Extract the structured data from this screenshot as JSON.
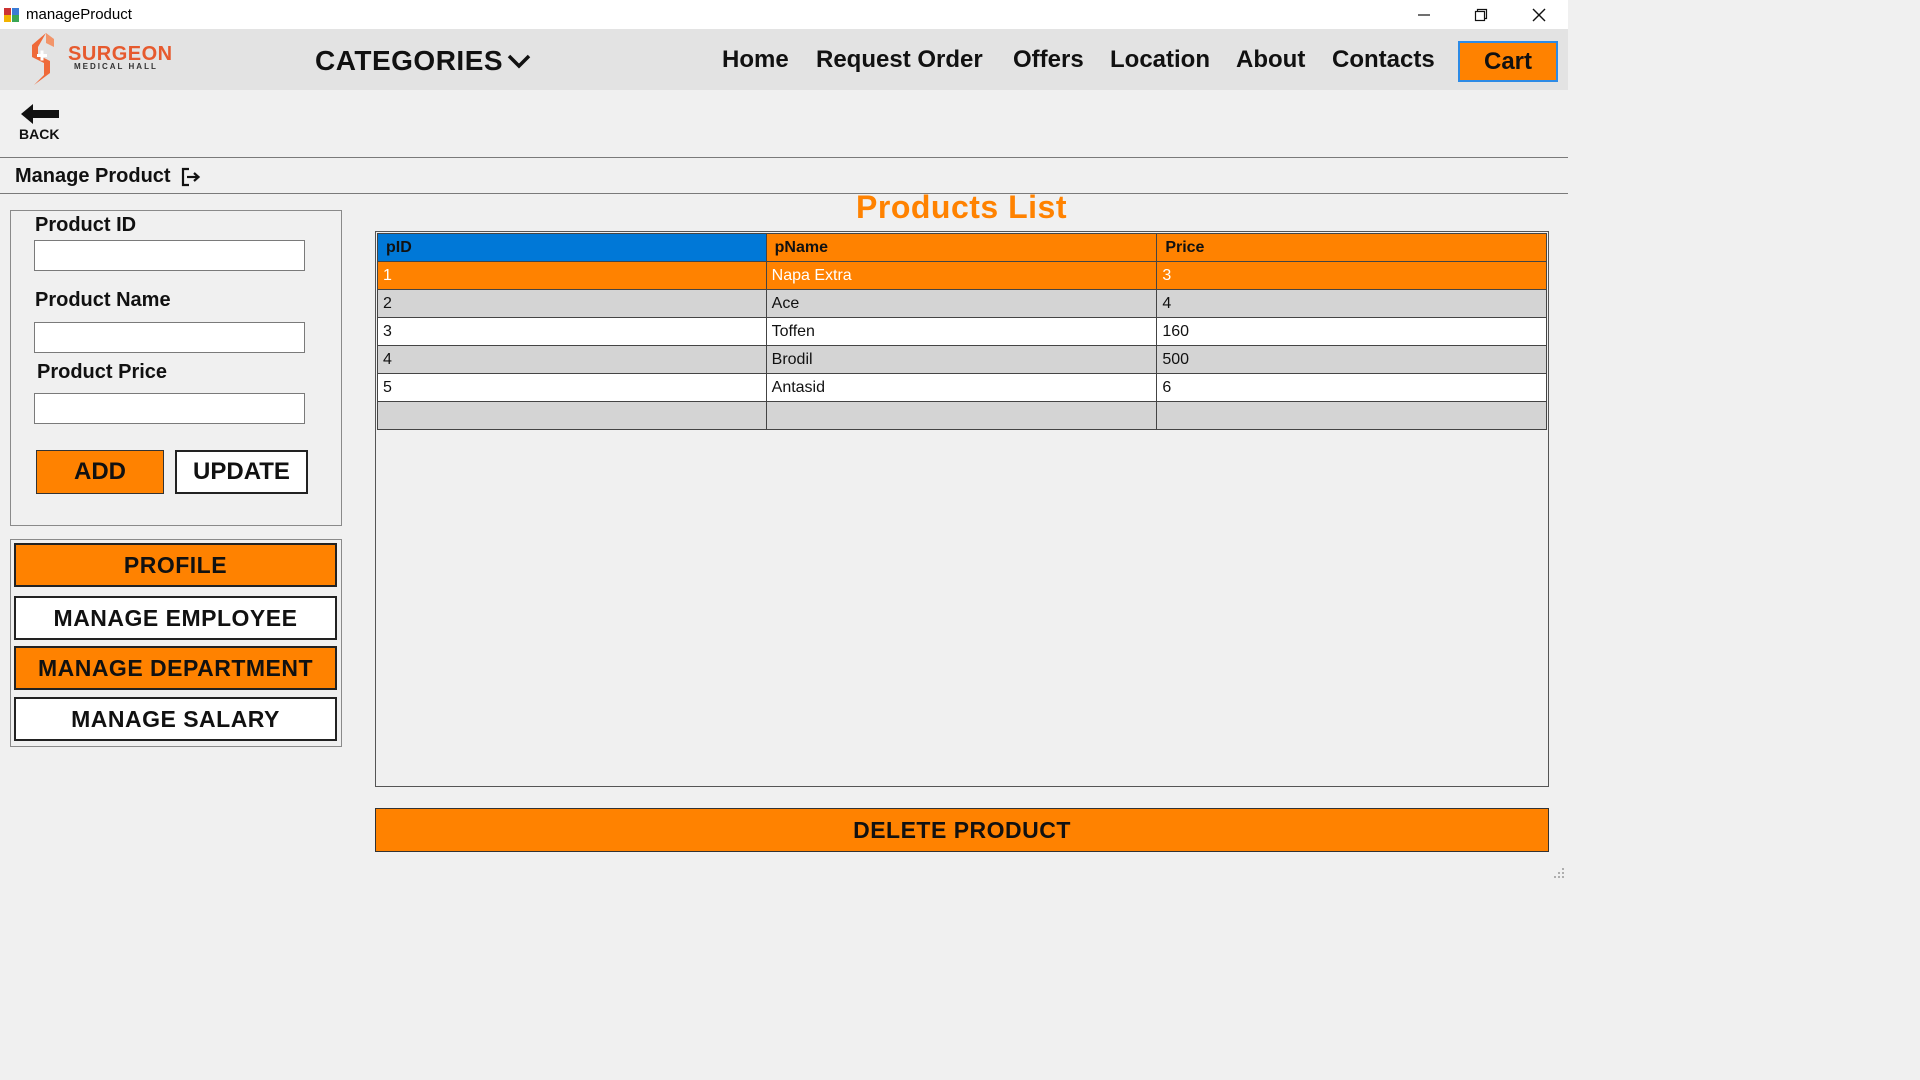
{
  "window": {
    "title": "manageProduct",
    "minimize_icon": "minimize-icon",
    "restore_icon": "restore-icon",
    "close_icon": "close-icon"
  },
  "navbar": {
    "logo_line1": "SURGEON",
    "logo_line2": "MEDICAL HALL",
    "categories": "CATEGORIES",
    "links": [
      "Home",
      "Request Order",
      "Offers",
      "Location",
      "About",
      "Contacts"
    ],
    "cart": "Cart"
  },
  "back": {
    "label": "BACK"
  },
  "section": {
    "title": "Manage Product"
  },
  "form": {
    "product_id_label": "Product ID",
    "product_id_value": "",
    "product_name_label": "Product Name",
    "product_name_value": "",
    "product_price_label": "Product Price",
    "product_price_value": "",
    "add_label": "ADD",
    "update_label": "UPDATE"
  },
  "menu": {
    "profile": "PROFILE",
    "manage_employee": "MANAGE EMPLOYEE",
    "manage_department": "MANAGE DEPARTMENT",
    "manage_salary": "MANAGE SALARY"
  },
  "products": {
    "title": "Products List",
    "columns": [
      "pID",
      "pName",
      "Price"
    ],
    "rows": [
      [
        "1",
        "Napa Extra",
        "3"
      ],
      [
        "2",
        "Ace",
        "4"
      ],
      [
        "3",
        "Toffen",
        "160"
      ],
      [
        "4",
        "Brodil",
        "500"
      ],
      [
        "5",
        "Antasid",
        "6"
      ],
      [
        "",
        "",
        ""
      ]
    ],
    "delete_label": "DELETE PRODUCT"
  },
  "colors": {
    "accent": "#ff8200",
    "header_selected": "#0078d7",
    "row_alt": "#d4d4d4",
    "background": "#f0f0f0"
  }
}
